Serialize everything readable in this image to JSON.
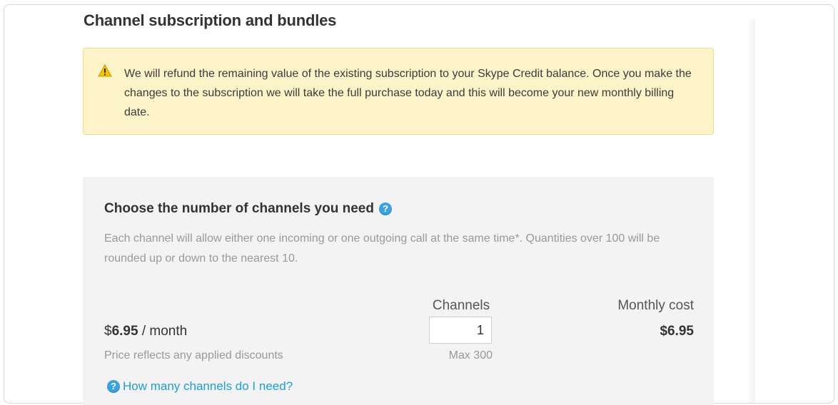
{
  "page": {
    "title": "Channel subscription and bundles"
  },
  "alert": {
    "icon": "warning-icon",
    "message": "We will refund the remaining value of the existing subscription to your Skype Credit balance. Once you make the changes to the subscription we will take the full purchase today and this will become your new monthly billing date."
  },
  "channels_panel": {
    "heading": "Choose the number of channels you need",
    "heading_icon": "help-icon",
    "description": "Each channel will allow either one incoming or one outgoing call at the same time*. Quantities over 100 will be rounded up or down to the nearest 10.",
    "columns": {
      "channels": "Channels",
      "monthly_cost": "Monthly cost"
    },
    "price_currency": "$",
    "price_amount": "6.95",
    "price_period": " / month",
    "channels_value": "1",
    "monthly_cost_value": "$6.95",
    "price_note": "Price reflects any applied discounts",
    "max_note": "Max 300",
    "help_link": "How many channels do I need?"
  },
  "colors": {
    "alert_bg": "#fdf3c8",
    "panel_bg": "#f3f3f3",
    "link": "#1a9fdb"
  }
}
